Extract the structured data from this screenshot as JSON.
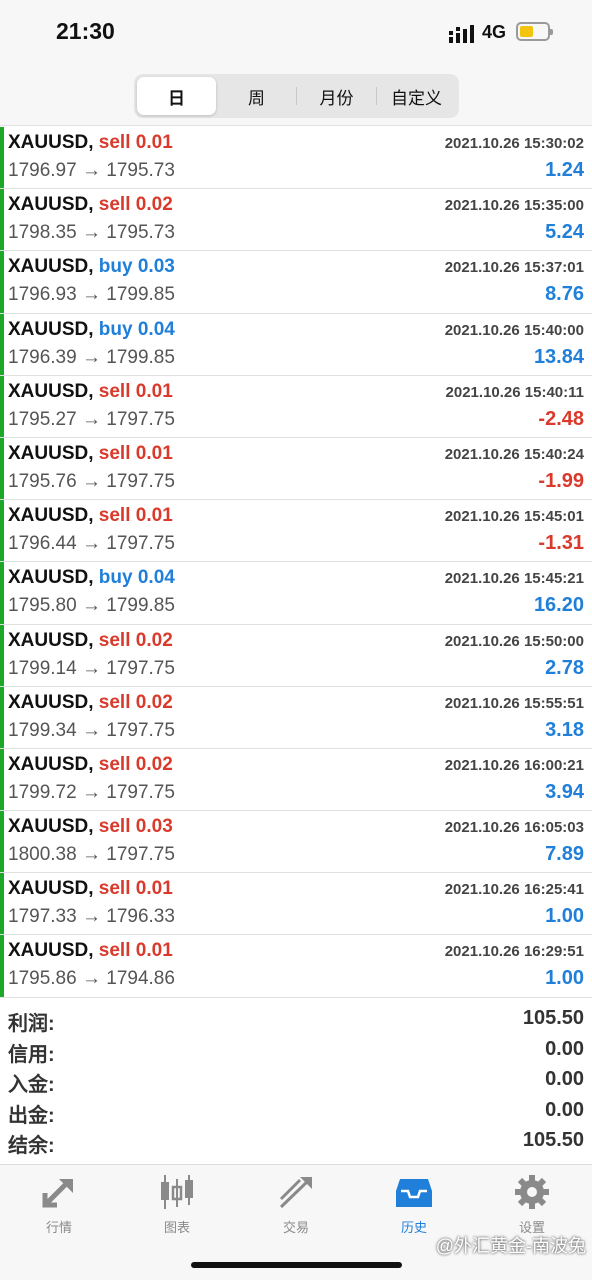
{
  "status_bar": {
    "time": "21:30",
    "network": "4G",
    "battery_level": 0.5
  },
  "segment": {
    "items": [
      "日",
      "周",
      "月份",
      "自定义"
    ],
    "selected_index": 0
  },
  "trades": [
    {
      "symbol": "XAUUSD,",
      "side": "sell",
      "volume": "0.01",
      "datetime": "2021.10.26 15:30:02",
      "open": "1796.97",
      "close": "1795.73",
      "profit": "1.24"
    },
    {
      "symbol": "XAUUSD,",
      "side": "sell",
      "volume": "0.02",
      "datetime": "2021.10.26 15:35:00",
      "open": "1798.35",
      "close": "1795.73",
      "profit": "5.24"
    },
    {
      "symbol": "XAUUSD,",
      "side": "buy",
      "volume": "0.03",
      "datetime": "2021.10.26 15:37:01",
      "open": "1796.93",
      "close": "1799.85",
      "profit": "8.76"
    },
    {
      "symbol": "XAUUSD,",
      "side": "buy",
      "volume": "0.04",
      "datetime": "2021.10.26 15:40:00",
      "open": "1796.39",
      "close": "1799.85",
      "profit": "13.84"
    },
    {
      "symbol": "XAUUSD,",
      "side": "sell",
      "volume": "0.01",
      "datetime": "2021.10.26 15:40:11",
      "open": "1795.27",
      "close": "1797.75",
      "profit": "-2.48"
    },
    {
      "symbol": "XAUUSD,",
      "side": "sell",
      "volume": "0.01",
      "datetime": "2021.10.26 15:40:24",
      "open": "1795.76",
      "close": "1797.75",
      "profit": "-1.99"
    },
    {
      "symbol": "XAUUSD,",
      "side": "sell",
      "volume": "0.01",
      "datetime": "2021.10.26 15:45:01",
      "open": "1796.44",
      "close": "1797.75",
      "profit": "-1.31"
    },
    {
      "symbol": "XAUUSD,",
      "side": "buy",
      "volume": "0.04",
      "datetime": "2021.10.26 15:45:21",
      "open": "1795.80",
      "close": "1799.85",
      "profit": "16.20"
    },
    {
      "symbol": "XAUUSD,",
      "side": "sell",
      "volume": "0.02",
      "datetime": "2021.10.26 15:50:00",
      "open": "1799.14",
      "close": "1797.75",
      "profit": "2.78"
    },
    {
      "symbol": "XAUUSD,",
      "side": "sell",
      "volume": "0.02",
      "datetime": "2021.10.26 15:55:51",
      "open": "1799.34",
      "close": "1797.75",
      "profit": "3.18"
    },
    {
      "symbol": "XAUUSD,",
      "side": "sell",
      "volume": "0.02",
      "datetime": "2021.10.26 16:00:21",
      "open": "1799.72",
      "close": "1797.75",
      "profit": "3.94"
    },
    {
      "symbol": "XAUUSD,",
      "side": "sell",
      "volume": "0.03",
      "datetime": "2021.10.26 16:05:03",
      "open": "1800.38",
      "close": "1797.75",
      "profit": "7.89"
    },
    {
      "symbol": "XAUUSD,",
      "side": "sell",
      "volume": "0.01",
      "datetime": "2021.10.26 16:25:41",
      "open": "1797.33",
      "close": "1796.33",
      "profit": "1.00"
    },
    {
      "symbol": "XAUUSD,",
      "side": "sell",
      "volume": "0.01",
      "datetime": "2021.10.26 16:29:51",
      "open": "1795.86",
      "close": "1794.86",
      "profit": "1.00"
    }
  ],
  "arrow": "→",
  "summary": [
    {
      "label": "利润:",
      "value": "105.50"
    },
    {
      "label": "信用:",
      "value": "0.00"
    },
    {
      "label": "入金:",
      "value": "0.00"
    },
    {
      "label": "出金:",
      "value": "0.00"
    },
    {
      "label": "结余:",
      "value": "105.50"
    }
  ],
  "tabs": [
    {
      "label": "行情",
      "icon": "quotes-icon",
      "active": false
    },
    {
      "label": "图表",
      "icon": "chart-icon",
      "active": false
    },
    {
      "label": "交易",
      "icon": "trade-icon",
      "active": false
    },
    {
      "label": "历史",
      "icon": "history-icon",
      "active": true
    },
    {
      "label": "设置",
      "icon": "settings-icon",
      "active": false
    }
  ],
  "watermark": "@外汇黄金-南波兔",
  "colors": {
    "sell": "#d93a2b",
    "buy": "#1f7fd9",
    "profit_positive": "#1f7fd9",
    "profit_negative": "#d93a2b",
    "row_accent": "#1fa828",
    "tab_active": "#1f7fd9",
    "tab_inactive": "#8a8a8a"
  }
}
